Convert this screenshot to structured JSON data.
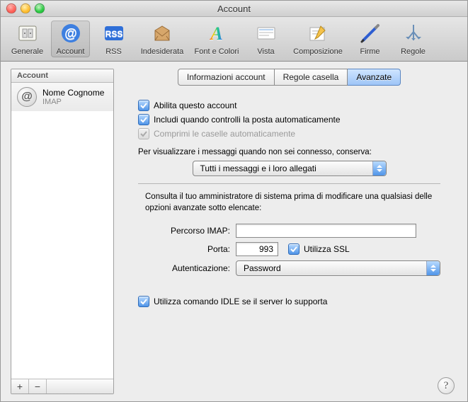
{
  "window": {
    "title": "Account"
  },
  "toolbar": {
    "items": [
      {
        "label": "Generale"
      },
      {
        "label": "Account"
      },
      {
        "label": "RSS"
      },
      {
        "label": "Indesiderata"
      },
      {
        "label": "Font e Colori"
      },
      {
        "label": "Vista"
      },
      {
        "label": "Composizione"
      },
      {
        "label": "Firme"
      },
      {
        "label": "Regole"
      }
    ]
  },
  "sidebar": {
    "header": "Account",
    "account": {
      "name": "Nome Cognome",
      "type": "IMAP"
    },
    "buttons": {
      "add": "+",
      "remove": "−"
    }
  },
  "tabs": {
    "items": [
      {
        "label": "Informazioni account"
      },
      {
        "label": "Regole casella"
      },
      {
        "label": "Avanzate"
      }
    ]
  },
  "form": {
    "enable": "Abilita questo account",
    "include": "Includi quando controlli la posta automaticamente",
    "compress": "Comprimi le caselle automaticamente",
    "offline_note": "Per visualizzare i messaggi quando non sei connesso, conserva:",
    "offline_select": "Tutti i messaggi e i loro allegati",
    "admin_note": "Consulta il tuo amministratore di sistema prima di modificare una qualsiasi delle opzioni avanzate sotto elencate:",
    "imap_path_label": "Percorso IMAP:",
    "imap_path_value": "",
    "port_label": "Porta:",
    "port_value": "993",
    "ssl_label": "Utilizza SSL",
    "auth_label": "Autenticazione:",
    "auth_value": "Password",
    "idle": "Utilizza comando IDLE se il server lo supporta"
  },
  "help": "?"
}
